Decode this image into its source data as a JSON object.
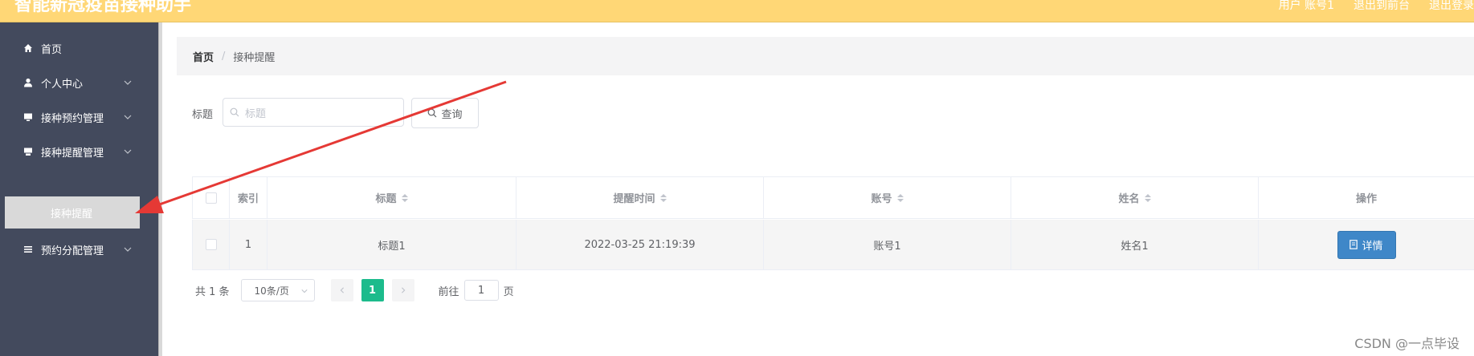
{
  "app": {
    "title": "智能新冠疫苗接种助手"
  },
  "topbar": {
    "links": [
      "用户 账号1",
      "退出到前台",
      "退出登录"
    ]
  },
  "sidebar": {
    "items": [
      {
        "label": "首页",
        "icon": "home-icon"
      },
      {
        "label": "个人中心",
        "icon": "user-icon"
      },
      {
        "label": "接种预约管理",
        "icon": "monitor-icon"
      },
      {
        "label": "接种提醒管理",
        "icon": "printer-icon"
      },
      {
        "label": "预约分配管理",
        "icon": "list-icon"
      }
    ],
    "active_subitem": "接种提醒"
  },
  "breadcrumb": {
    "home": "首页",
    "separator": "/",
    "current": "接种提醒"
  },
  "search": {
    "label": "标题",
    "placeholder": "标题",
    "button_label": "查询"
  },
  "table": {
    "headers": [
      "索引",
      "标题",
      "提醒时间",
      "账号",
      "姓名",
      "操作"
    ],
    "rows": [
      {
        "index": "1",
        "title": "标题1",
        "remind_time": "2022-03-25 21:19:39",
        "account": "账号1",
        "name": "姓名1",
        "action": "详情"
      }
    ]
  },
  "pagination": {
    "total_text": "共 1 条",
    "page_size": "10条/页",
    "current_page": "1",
    "goto_prefix": "前往",
    "goto_value": "1",
    "goto_suffix": "页"
  },
  "watermark": "CSDN @一点毕设",
  "colors": {
    "topbar": "#ffd776",
    "sidebar": "#434a5d",
    "primary_button": "#3f87c8",
    "active_page": "#1cbb8c",
    "arrow": "#e53935"
  }
}
